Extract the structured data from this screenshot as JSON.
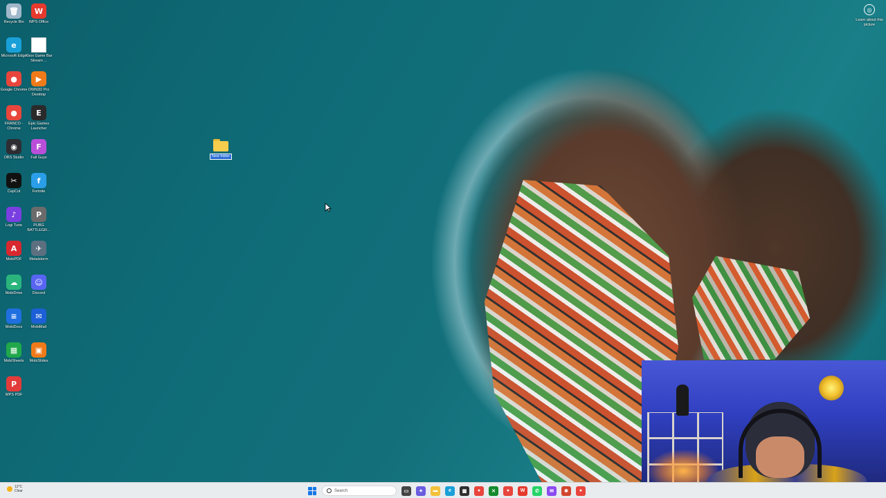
{
  "desktop": {
    "icons": [
      {
        "label": "Recycle Bin",
        "icon": "recycle-bin-icon",
        "color": "#9fb7c9",
        "glyph": "🗑"
      },
      {
        "label": "WPS Office",
        "icon": "wps-office-icon",
        "color": "#e63a2e",
        "glyph": "W"
      },
      {
        "label": "Microsoft Edge",
        "icon": "edge-icon",
        "color": "#1aa0d8",
        "glyph": "e"
      },
      {
        "label": "Xbox Game Bar Stream ...",
        "icon": "file-icon",
        "color": "#ffffff",
        "glyph": ""
      },
      {
        "label": "Google Chrome",
        "icon": "chrome-icon",
        "color": "#e8453c",
        "glyph": "●"
      },
      {
        "label": "OWN3D Pro Desktop",
        "icon": "own3d-icon",
        "color": "#f07a1a",
        "glyph": "▶"
      },
      {
        "label": "FRANCO - Chrome",
        "icon": "chrome-profile-icon",
        "color": "#e8453c",
        "glyph": "●"
      },
      {
        "label": "Epic Games Launcher",
        "icon": "epic-games-icon",
        "color": "#2a2a2a",
        "glyph": "E"
      },
      {
        "label": "OBS Studio",
        "icon": "obs-icon",
        "color": "#2d2d33",
        "glyph": "◉"
      },
      {
        "label": "Fall Guys",
        "icon": "fall-guys-icon",
        "color": "#b94fd8",
        "glyph": "F"
      },
      {
        "label": "CapCut",
        "icon": "capcut-icon",
        "color": "#111111",
        "glyph": "✂"
      },
      {
        "label": "Fortnite",
        "icon": "fortnite-icon",
        "color": "#2a9ee8",
        "glyph": "f"
      },
      {
        "label": "Logi Tune",
        "icon": "logi-tune-icon",
        "color": "#7a3fe0",
        "glyph": "♪"
      },
      {
        "label": "PUBG BATTLEGR...",
        "icon": "pubg-icon",
        "color": "#6b6b6b",
        "glyph": "P"
      },
      {
        "label": "MobiPDF",
        "icon": "mobipdf-icon",
        "color": "#d8282f",
        "glyph": "A"
      },
      {
        "label": "Metalstorm",
        "icon": "metalstorm-icon",
        "color": "#5c7080",
        "glyph": "✈"
      },
      {
        "label": "MobiDrive",
        "icon": "mobidrive-icon",
        "color": "#2ab57d",
        "glyph": "☁"
      },
      {
        "label": "Discord",
        "icon": "discord-icon",
        "color": "#5865f2",
        "glyph": "☺"
      },
      {
        "label": "MobiDocs",
        "icon": "mobidocs-icon",
        "color": "#1f6fe0",
        "glyph": "≡"
      },
      {
        "label": "MobiMail",
        "icon": "mobimail-icon",
        "color": "#1d5fd6",
        "glyph": "✉"
      },
      {
        "label": "MobiSheets",
        "icon": "mobisheets-icon",
        "color": "#20a84a",
        "glyph": "▦"
      },
      {
        "label": "MobiSlides",
        "icon": "mobislides-icon",
        "color": "#f07a1a",
        "glyph": "▣"
      },
      {
        "label": "WPS PDF",
        "icon": "wps-pdf-icon",
        "color": "#e23b3b",
        "glyph": "P"
      }
    ],
    "new_folder": {
      "label": "New folder"
    },
    "learn_about": {
      "label": "Learn about this picture"
    }
  },
  "taskbar": {
    "weather": {
      "temp": "12°C",
      "condition": "Clear"
    },
    "search_placeholder": "Search",
    "apps": [
      {
        "name": "task-view-icon",
        "color": "#444444",
        "glyph": "▭"
      },
      {
        "name": "copilot-icon",
        "color": "#6a5de0",
        "glyph": "✦"
      },
      {
        "name": "file-explorer-icon",
        "color": "#f3c13a",
        "glyph": "▬"
      },
      {
        "name": "edge-taskbar-icon",
        "color": "#1aa0d8",
        "glyph": "e"
      },
      {
        "name": "store-icon",
        "color": "#2e2e2e",
        "glyph": "▦"
      },
      {
        "name": "chrome-taskbar-icon",
        "color": "#e8453c",
        "glyph": "●"
      },
      {
        "name": "xbox-icon",
        "color": "#138a2e",
        "glyph": "✕"
      },
      {
        "name": "chrome-profile-taskbar-icon",
        "color": "#e8453c",
        "glyph": "●"
      },
      {
        "name": "wps-taskbar-icon",
        "color": "#e63a2e",
        "glyph": "W"
      },
      {
        "name": "whatsapp-icon",
        "color": "#25d366",
        "glyph": "✆"
      },
      {
        "name": "messenger-icon",
        "color": "#8a4bf0",
        "glyph": "✉"
      },
      {
        "name": "ai-app-icon",
        "color": "#d2452d",
        "glyph": "✱"
      },
      {
        "name": "chrome-extra-taskbar-icon",
        "color": "#e8453c",
        "glyph": "●"
      }
    ]
  }
}
